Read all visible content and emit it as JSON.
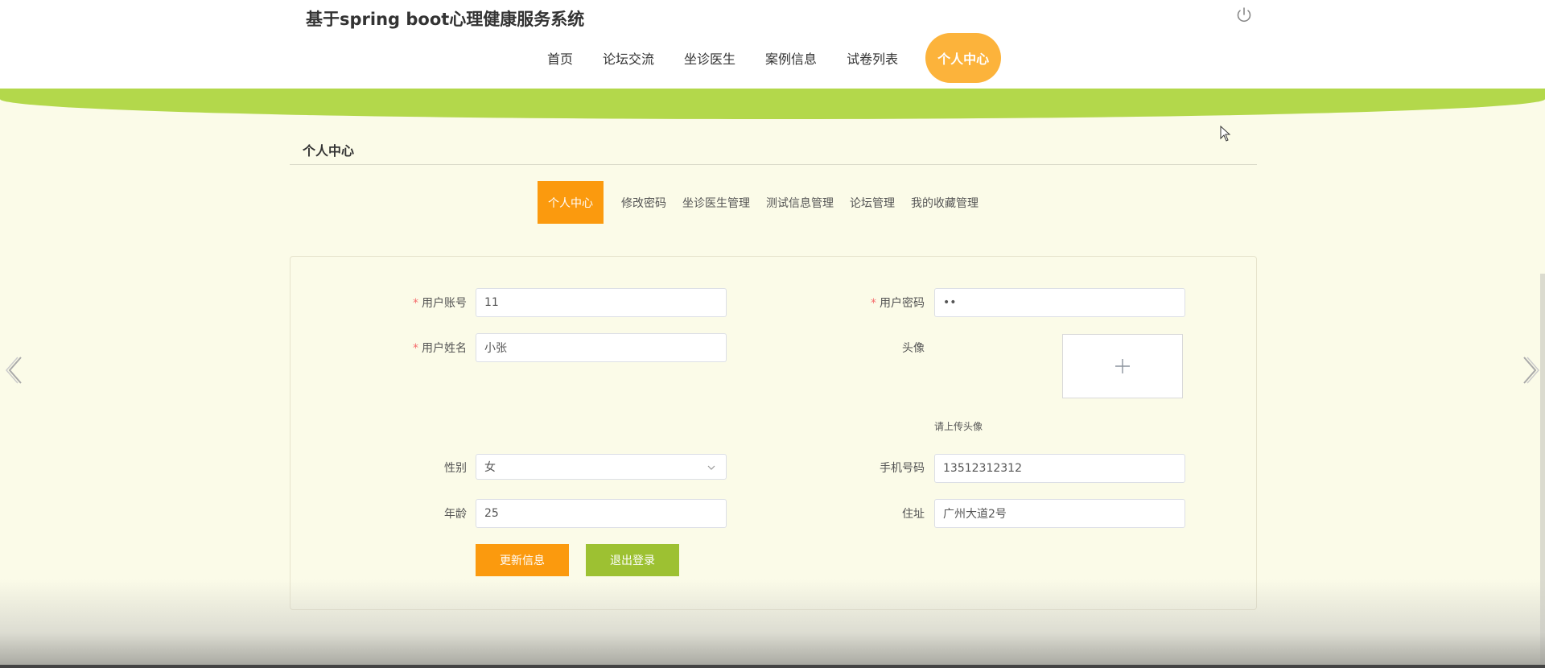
{
  "header": {
    "title": "基于spring boot心理健康服务系统",
    "nav": [
      {
        "label": "首页",
        "active": false
      },
      {
        "label": "论坛交流",
        "active": false
      },
      {
        "label": "坐诊医生",
        "active": false
      },
      {
        "label": "案例信息",
        "active": false
      },
      {
        "label": "试卷列表",
        "active": false
      },
      {
        "label": "个人中心",
        "active": true
      }
    ],
    "power_icon": "power-icon"
  },
  "section": {
    "title": "个人中心"
  },
  "tabs": [
    {
      "label": "个人中心",
      "active": true
    },
    {
      "label": "修改密码",
      "active": false
    },
    {
      "label": "坐诊医生管理",
      "active": false
    },
    {
      "label": "测试信息管理",
      "active": false
    },
    {
      "label": "论坛管理",
      "active": false
    },
    {
      "label": "我的收藏管理",
      "active": false
    }
  ],
  "form": {
    "account": {
      "label": "用户账号",
      "required": "*",
      "value": "11"
    },
    "password": {
      "label": "用户密码",
      "required": "*",
      "value": "••"
    },
    "name": {
      "label": "用户姓名",
      "required": "*",
      "value": "小张"
    },
    "avatar": {
      "label": "头像",
      "upload_icon": "plus-icon",
      "tip": "请上传头像"
    },
    "gender": {
      "label": "性别",
      "value": "女"
    },
    "phone": {
      "label": "手机号码",
      "value": "13512312312"
    },
    "age": {
      "label": "年龄",
      "value": "25"
    },
    "address": {
      "label": "住址",
      "value": "广州大道2号"
    },
    "update_button": "更新信息",
    "logout_button": "退出登录"
  },
  "colors": {
    "accent_orange": "#fb9a0e",
    "accent_green": "#9dc132",
    "wave_green": "#b3d84b",
    "nav_active": "#fcb33b",
    "background": "#fbfbe8"
  }
}
